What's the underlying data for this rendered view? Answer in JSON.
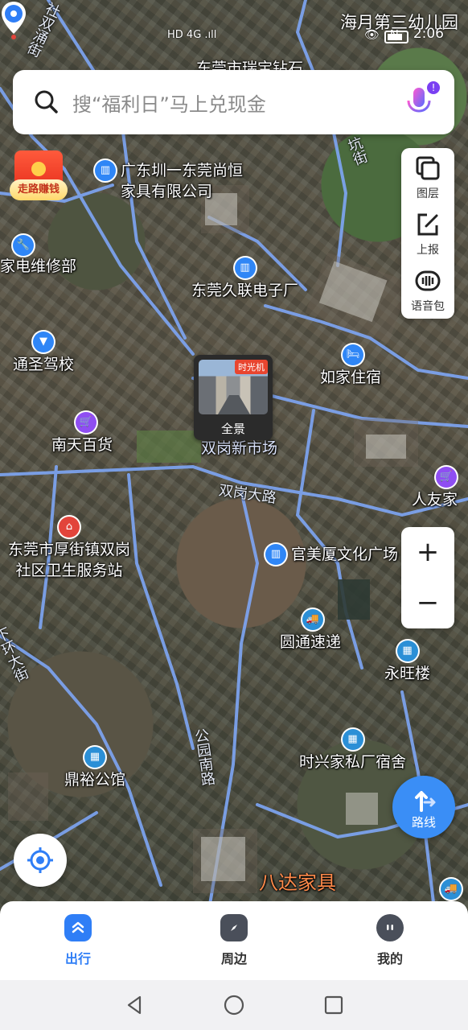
{
  "status_bar": {
    "hd_text": "HD 4G .ıll",
    "icons": "👁 N",
    "time": "2:06",
    "corner_poi": "海月第三幼儿园"
  },
  "search": {
    "placeholder": "搜“福利日”马上兑现金",
    "icon": "search-icon",
    "voice_icon": "microphone-icon",
    "voice_badge": "!"
  },
  "envelope": {
    "label": "走路赚钱"
  },
  "tools": [
    {
      "label": "图层",
      "icon": "layers-icon"
    },
    {
      "label": "上报",
      "icon": "report-edit-icon"
    },
    {
      "label": "语音包",
      "icon": "voice-pack-icon"
    }
  ],
  "zoom": {
    "in": "+",
    "out": "−"
  },
  "panorama": {
    "badge": "时光机",
    "caption": "全景"
  },
  "pois": {
    "top_partial": "东莞市瑞宝钻石",
    "furniture_co_line1": "广东圳一东莞尚恒",
    "furniture_co_line2": "家具有限公司",
    "appliance_repair": "家电维修部",
    "electronics_factory": "东莞久联电子厂",
    "driving_school": "通圣驾校",
    "hostel": "如家住宿",
    "nantian_store": "南天百货",
    "market": "双岗新市场",
    "renyou": "人友家",
    "health_station_line1": "东莞市厚街镇双岗",
    "health_station_line2": "社区卫生服务站",
    "cultural_plaza": "官美厦文化广场",
    "yto_express": "圆通速递",
    "yongwang": "永旺楼",
    "dormitory": "时兴家私厂宿舍",
    "dingyu_hall": "鼎裕公馆",
    "bada_furniture": "八达家具",
    "road_shuanggang": "双岗大路",
    "road_gongyuan": "公园南路",
    "road_left_top": "社双涌街",
    "road_left_mid": "下环大街",
    "road_right_top": "坑街"
  },
  "route_button": {
    "label": "路线"
  },
  "tabs": [
    {
      "label": "出行",
      "icon": "travel-icon",
      "active": true
    },
    {
      "label": "周边",
      "icon": "compass-icon",
      "active": false
    },
    {
      "label": "我的",
      "icon": "profile-icon",
      "active": false
    }
  ],
  "colors": {
    "accent": "#2f7ef6",
    "road": "#7aa2f0",
    "envelope": "#e8321e",
    "poi_blue": "#2f86f6",
    "poi_purple": "#8f4ef2",
    "poi_red": "#e2443b"
  }
}
